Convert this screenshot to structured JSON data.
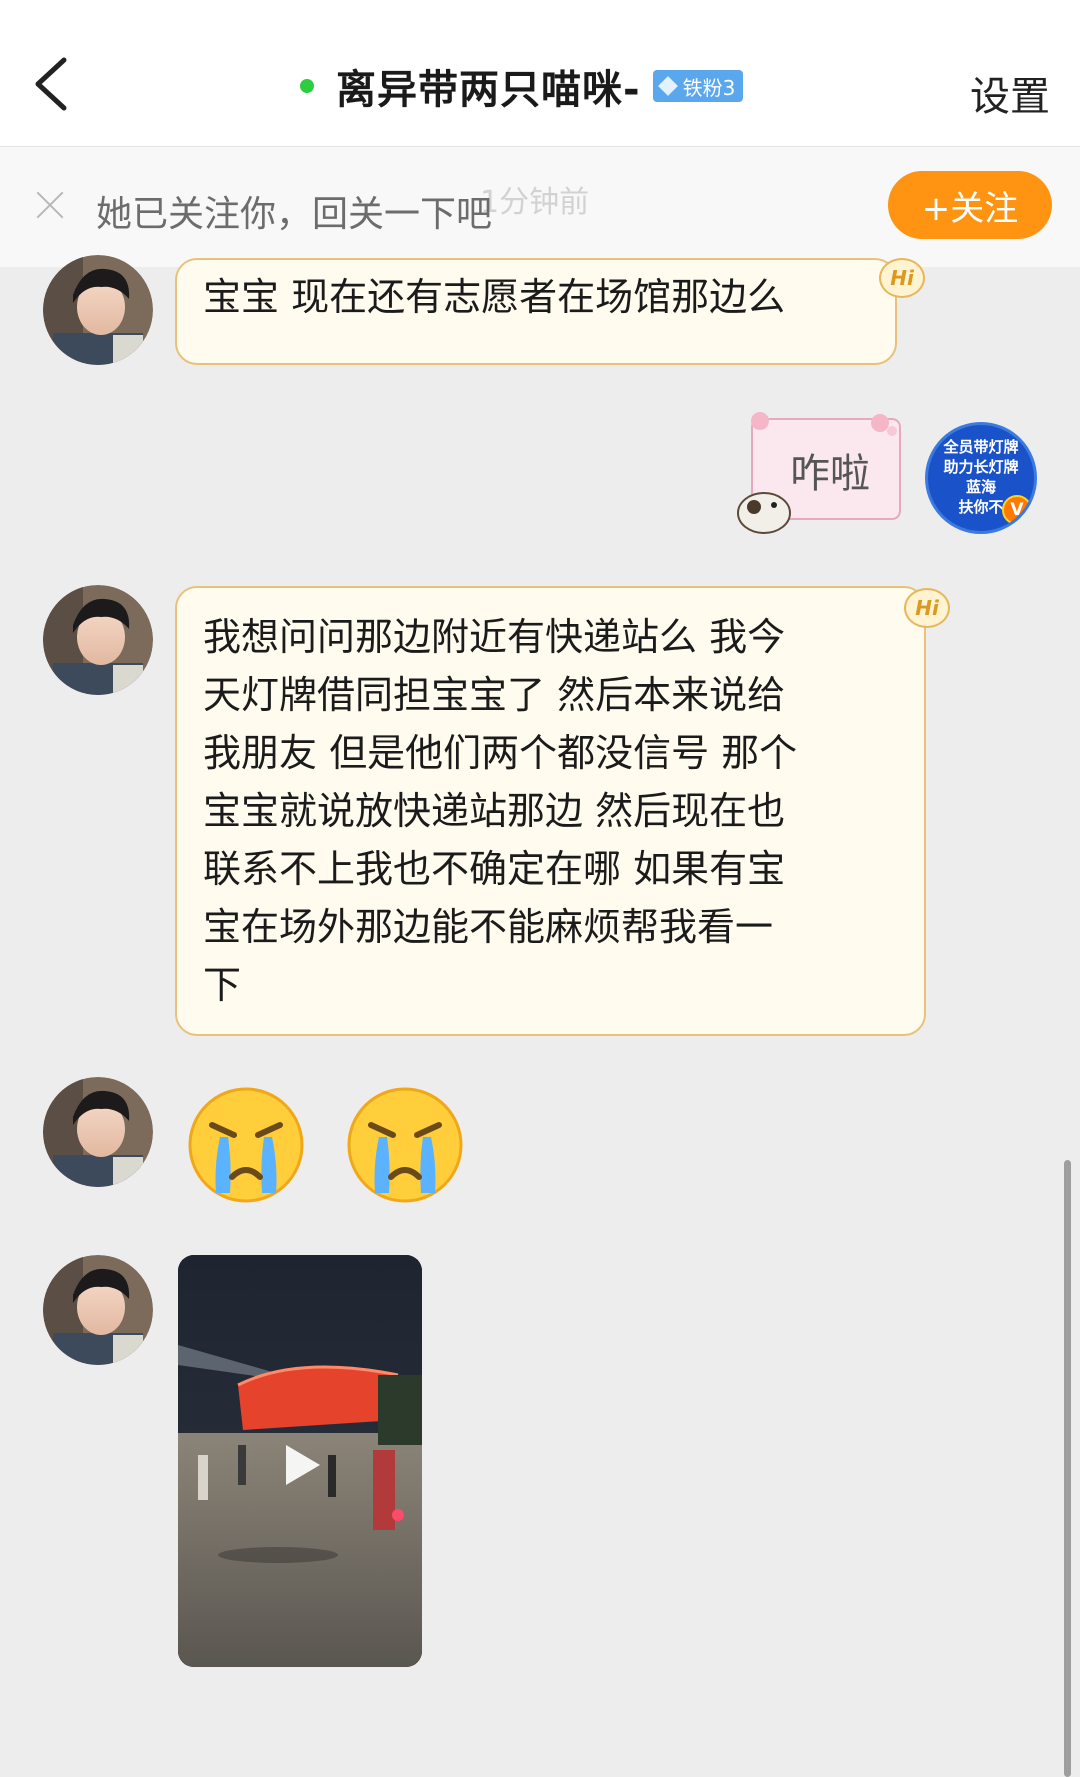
{
  "header": {
    "back_icon": "chevron-left-icon",
    "title": "离异带两只喵咪-",
    "online": true,
    "fan_badge": "铁粉3",
    "settings_label": "设置"
  },
  "follow_bar": {
    "text": "她已关注你，回关一下吧",
    "button_label": "+关注",
    "faded_time": "1分钟前",
    "accent": "#ff9412"
  },
  "messages": [
    {
      "sender": "other",
      "type": "text",
      "text": "宝宝 现在还有志愿者在场馆那边么",
      "tag": "Hi"
    },
    {
      "sender": "self",
      "type": "sticker",
      "text": "咋啦",
      "avatar_text": [
        "全员带灯牌",
        "助力长灯牌",
        "蓝海",
        "扶你不"
      ],
      "avatar_badge": "V"
    },
    {
      "sender": "other",
      "type": "text",
      "tag": "Hi",
      "lines": [
        "我想问问那边附近有快递站么 我今",
        "天灯牌借同担宝宝了 然后本来说给",
        "我朋友 但是他们两个都没信号 那个",
        "宝宝就说放快递站那边 然后现在也",
        "联系不上我也不确定在哪 如果有宝",
        "宝在场外那边能不能麻烦帮我看一",
        "下"
      ]
    },
    {
      "sender": "other",
      "type": "emoji",
      "emojis": [
        "crying-face-icon",
        "crying-face-icon"
      ]
    },
    {
      "sender": "other",
      "type": "video",
      "icon": "play-icon"
    }
  ],
  "colors": {
    "bubble_bg": "#fffbef",
    "bubble_border": "#e8c27a",
    "chat_bg": "#ededed",
    "online": "#2ecc40"
  }
}
